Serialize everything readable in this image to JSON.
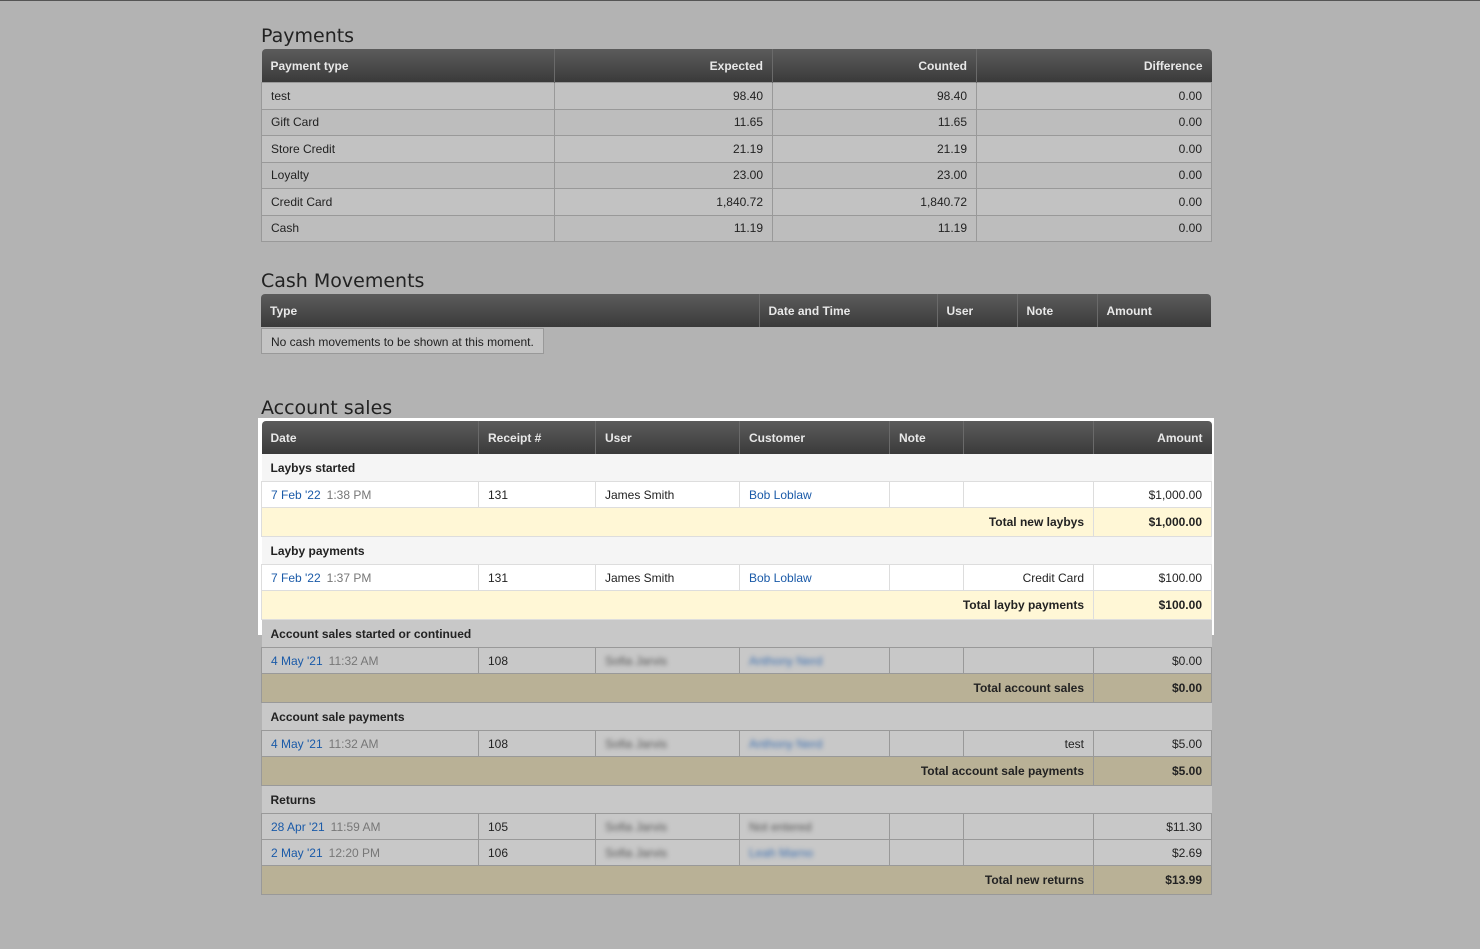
{
  "payments": {
    "title": "Payments",
    "headers": [
      "Payment type",
      "Expected",
      "Counted",
      "Difference"
    ],
    "rows": [
      [
        "test",
        "98.40",
        "98.40",
        "0.00"
      ],
      [
        "Gift Card",
        "11.65",
        "11.65",
        "0.00"
      ],
      [
        "Store Credit",
        "21.19",
        "21.19",
        "0.00"
      ],
      [
        "Loyalty",
        "23.00",
        "23.00",
        "0.00"
      ],
      [
        "Credit Card",
        "1,840.72",
        "1,840.72",
        "0.00"
      ],
      [
        "Cash",
        "11.19",
        "11.19",
        "0.00"
      ]
    ]
  },
  "cash_movements": {
    "title": "Cash Movements",
    "headers": [
      "Type",
      "Date and Time",
      "User",
      "Note",
      "Amount"
    ],
    "empty_text": "No cash movements to be shown at this moment."
  },
  "account_sales": {
    "title": "Account sales",
    "headers": [
      "Date",
      "Receipt #",
      "User",
      "Customer",
      "Note",
      "",
      "Amount"
    ],
    "laybys_started": {
      "label": "Laybys started",
      "row": {
        "date": "7 Feb '22",
        "time": "1:38 PM",
        "receipt": "131",
        "user": "James Smith",
        "customer": "Bob Loblaw",
        "note": "",
        "type": "",
        "amount": "$1,000.00"
      },
      "total_label": "Total new laybys",
      "total": "$1,000.00"
    },
    "layby_payments": {
      "label": "Layby payments",
      "row": {
        "date": "7 Feb '22",
        "time": "1:37 PM",
        "receipt": "131",
        "user": "James Smith",
        "customer": "Bob Loblaw",
        "note": "",
        "type": "Credit Card",
        "amount": "$100.00"
      },
      "total_label": "Total layby payments",
      "total": "$100.00"
    },
    "account_started": {
      "label": "Account sales started or continued",
      "row": {
        "date": "4 May '21",
        "time": "11:32 AM",
        "receipt": "108",
        "user": "Sofia Jarvis",
        "customer": "Anthony Nerd",
        "note": "",
        "type": "",
        "amount": "$0.00"
      },
      "total_label": "Total account sales",
      "total": "$0.00"
    },
    "account_payments": {
      "label": "Account sale payments",
      "row": {
        "date": "4 May '21",
        "time": "11:32 AM",
        "receipt": "108",
        "user": "Sofia Jarvis",
        "customer": "Anthony Nerd",
        "note": "",
        "type": "test",
        "amount": "$5.00"
      },
      "total_label": "Total account sale payments",
      "total": "$5.00"
    },
    "returns": {
      "label": "Returns",
      "rows": [
        {
          "date": "28 Apr '21",
          "time": "11:59 AM",
          "receipt": "105",
          "user": "Sofia Jarvis",
          "customer": "Not entered",
          "note": "",
          "type": "",
          "amount": "$11.30"
        },
        {
          "date": "2 May '21",
          "time": "12:20 PM",
          "receipt": "106",
          "user": "Sofia Jarvis",
          "customer": "Leah Marno",
          "note": "",
          "type": "",
          "amount": "$2.69"
        }
      ],
      "total_label": "Total new returns",
      "total": "$13.99"
    }
  }
}
